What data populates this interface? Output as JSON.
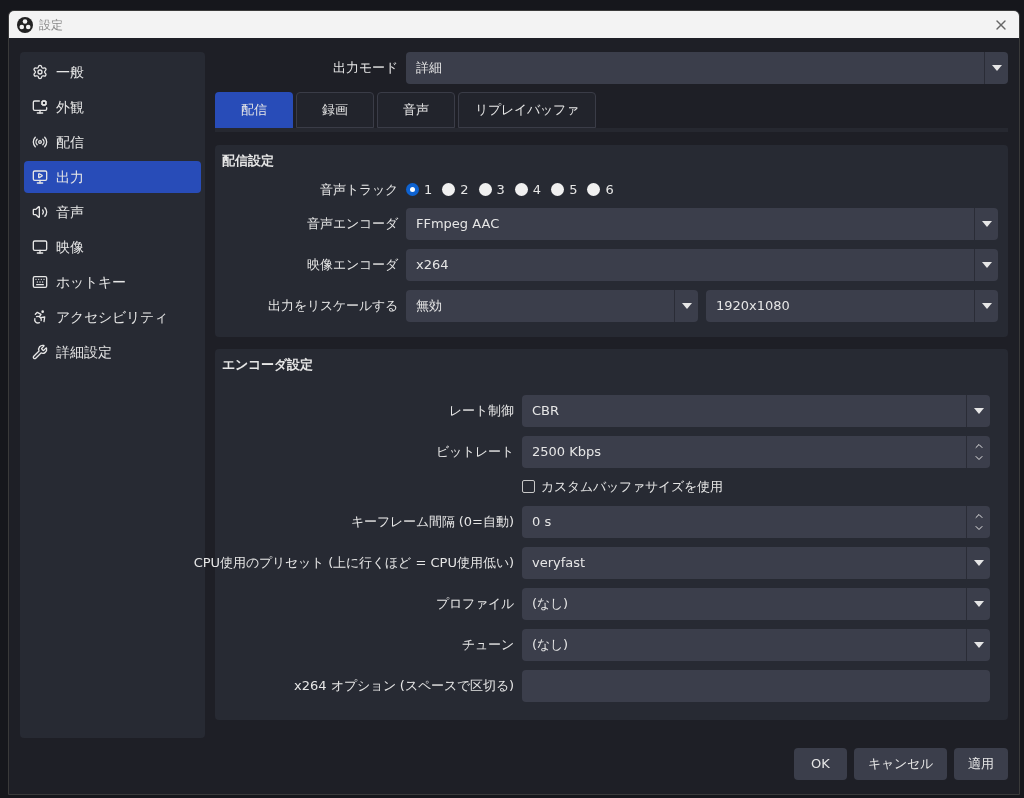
{
  "window": {
    "title": "設定"
  },
  "sidebar": {
    "items": [
      {
        "label": "一般",
        "selected": false
      },
      {
        "label": "外観",
        "selected": false
      },
      {
        "label": "配信",
        "selected": false
      },
      {
        "label": "出力",
        "selected": true
      },
      {
        "label": "音声",
        "selected": false
      },
      {
        "label": "映像",
        "selected": false
      },
      {
        "label": "ホットキー",
        "selected": false
      },
      {
        "label": "アクセシビリティ",
        "selected": false
      },
      {
        "label": "詳細設定",
        "selected": false
      }
    ]
  },
  "output_mode": {
    "label": "出力モード",
    "value": "詳細"
  },
  "tabs": [
    {
      "label": "配信",
      "selected": true
    },
    {
      "label": "録画",
      "selected": false
    },
    {
      "label": "音声",
      "selected": false
    },
    {
      "label": "リプレイバッファ",
      "selected": false
    }
  ],
  "stream_settings": {
    "title": "配信設定",
    "audio_track": {
      "label": "音声トラック",
      "options": [
        {
          "label": "1",
          "selected": true
        },
        {
          "label": "2",
          "selected": false
        },
        {
          "label": "3",
          "selected": false
        },
        {
          "label": "4",
          "selected": false
        },
        {
          "label": "5",
          "selected": false
        },
        {
          "label": "6",
          "selected": false
        }
      ]
    },
    "rows": [
      {
        "kind": "select",
        "label": "音声エンコーダ",
        "value": "FFmpeg AAC"
      },
      {
        "kind": "select",
        "label": "映像エンコーダ",
        "value": "x264"
      },
      {
        "kind": "dual_select",
        "label": "出力をリスケールする",
        "values": [
          "無効",
          "1920x1080"
        ]
      }
    ]
  },
  "encoder_settings": {
    "title": "エンコーダ設定",
    "rows": [
      {
        "kind": "select",
        "label": "レート制御",
        "value": "CBR"
      },
      {
        "kind": "spin",
        "label": "ビットレート",
        "value": "2500 Kbps"
      },
      {
        "kind": "checkbox",
        "label": "カスタムバッファサイズを使用",
        "checked": false
      },
      {
        "kind": "spin",
        "label": "キーフレーム間隔 (0=自動)",
        "value": "0 s"
      },
      {
        "kind": "select",
        "label": "CPU使用のプリセット (上に行くほど = CPU使用低い)",
        "value": "veryfast"
      },
      {
        "kind": "select",
        "label": "プロファイル",
        "value": "(なし)"
      },
      {
        "kind": "select",
        "label": "チューン",
        "value": "(なし)"
      },
      {
        "kind": "text",
        "label": "x264 オプション (スペースで区切る)"
      }
    ]
  },
  "buttons": [
    "OK",
    "キャンセル",
    "適用"
  ]
}
